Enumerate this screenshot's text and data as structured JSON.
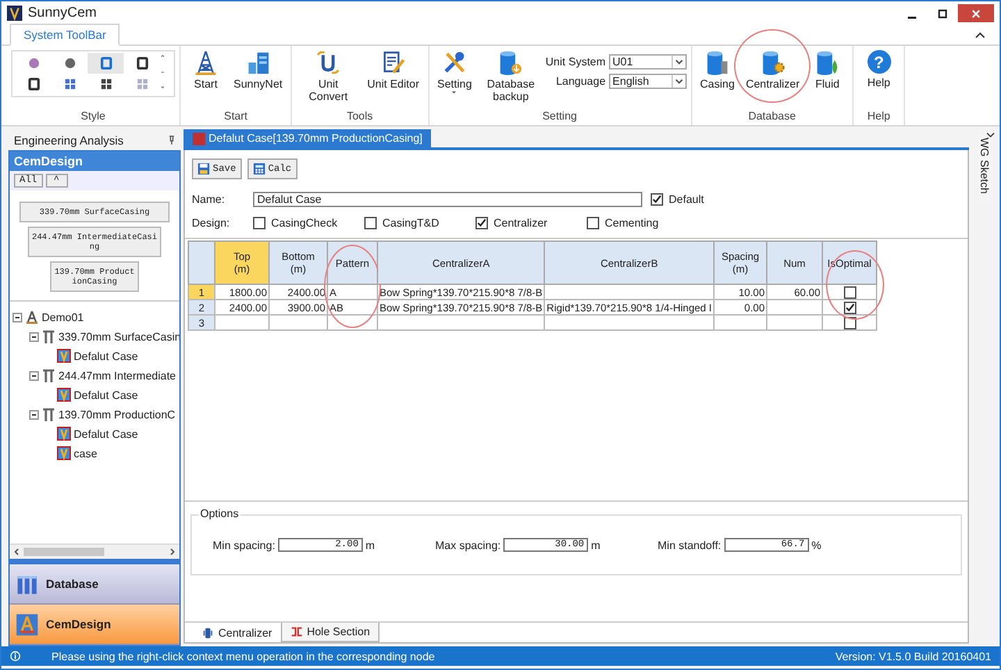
{
  "window": {
    "title": "SunnyCem"
  },
  "ribbon": {
    "tabs": [
      {
        "label": "System ToolBar",
        "selected": true
      }
    ],
    "style_gallery": [
      {
        "selected": false
      },
      {
        "selected": false
      },
      {
        "selected": true
      },
      {
        "selected": false
      },
      {
        "selected": false
      },
      {
        "selected": false
      },
      {
        "selected": false
      },
      {
        "selected": false
      }
    ],
    "groups": [
      {
        "label": "Style"
      },
      {
        "label": "Start",
        "buttons": [
          {
            "label": "Start",
            "circled": false
          },
          {
            "label": "SunnyNet",
            "circled": false
          }
        ]
      },
      {
        "label": "Tools",
        "buttons": [
          {
            "label": "Unit Convert",
            "circled": false
          },
          {
            "label": "Unit Editor",
            "circled": false
          }
        ]
      },
      {
        "label": "Setting",
        "buttons": [
          {
            "label": "Setting",
            "circled": false,
            "dropdown": true
          },
          {
            "label": "Database backup",
            "circled": false
          }
        ],
        "fields": [
          {
            "label": "Unit System",
            "value": "U01"
          },
          {
            "label": "Language",
            "value": "English"
          }
        ]
      },
      {
        "label": "Database",
        "buttons": [
          {
            "label": "Casing",
            "circled": false
          },
          {
            "label": "Centralizer",
            "circled": true
          },
          {
            "label": "Fluid",
            "circled": false
          }
        ]
      },
      {
        "label": "Help",
        "buttons": [
          {
            "label": "Help",
            "circled": false,
            "glyph": "?"
          }
        ]
      }
    ]
  },
  "sidebar": {
    "title": "Engineering Analysis",
    "section": "CemDesign",
    "tool_buttons": [
      {
        "label": "All"
      },
      {
        "label": "^"
      }
    ],
    "casing_buttons": [
      "339.70mm SurfaceCasing",
      "244.47mm IntermediateCasing",
      "139.70mm ProductionCasing"
    ],
    "tree": [
      {
        "label": "Demo01",
        "expanded": true,
        "children": [
          {
            "label": "339.70mm SurfaceCasin",
            "expanded": true,
            "children": [
              {
                "label": "Defalut Case"
              }
            ]
          },
          {
            "label": "244.47mm Intermediate",
            "expanded": true,
            "children": [
              {
                "label": "Defalut Case"
              }
            ]
          },
          {
            "label": "139.70mm ProductionC",
            "expanded": true,
            "children": [
              {
                "label": "Defalut Case"
              },
              {
                "label": "case"
              }
            ]
          }
        ]
      }
    ],
    "nav": [
      {
        "label": "Database",
        "selected": false
      },
      {
        "label": "CemDesign",
        "selected": true
      }
    ]
  },
  "document": {
    "tab": {
      "label": "Defalut Case[139.70mm ProductionCasing]",
      "selected": true
    },
    "toolbar": [
      "Save",
      "Calc"
    ],
    "name_label": "Name:",
    "name_value": "Defalut Case",
    "default": {
      "label": "Default",
      "checked": true
    },
    "design_label": "Design:",
    "design_options": [
      {
        "label": "CasingCheck",
        "checked": false
      },
      {
        "label": "CasingT&D",
        "checked": false
      },
      {
        "label": "Centralizer",
        "checked": true
      },
      {
        "label": "Cementing",
        "checked": false
      }
    ],
    "table": {
      "columns": [
        {
          "label": "Top\n(m)",
          "current": true,
          "circled": false
        },
        {
          "label": "Bottom\n(m)",
          "current": false,
          "circled": false
        },
        {
          "label": "Pattern",
          "current": false,
          "circled": true
        },
        {
          "label": "CentralizerA",
          "current": false,
          "circled": false
        },
        {
          "label": "CentralizerB",
          "current": false,
          "circled": false
        },
        {
          "label": "Spacing\n(m)",
          "current": false,
          "circled": false
        },
        {
          "label": "Num",
          "current": false,
          "circled": false
        },
        {
          "label": "IsOptimal",
          "current": false,
          "circled": true
        }
      ],
      "rows": [
        {
          "number": "1",
          "selected": true,
          "cells": [
            "1800.00",
            "2400.00",
            "A",
            "Bow Spring*139.70*215.90*8 7/8-B",
            null,
            "10.00",
            "60.00"
          ],
          "optimal": false
        },
        {
          "number": "2",
          "selected": false,
          "cells": [
            "2400.00",
            "3900.00",
            "AB",
            "Bow Spring*139.70*215.90*8 7/8-B",
            "Rigid*139.70*215.90*8 1/4-Hinged I",
            "0.00",
            null
          ],
          "optimal": true
        },
        {
          "number": "3",
          "selected": false,
          "cells": [
            null,
            null,
            null,
            null,
            null,
            null,
            null
          ],
          "optimal": false
        }
      ]
    },
    "options": {
      "title": "Options",
      "fields": [
        {
          "label": "Min spacing:",
          "value": "2.00",
          "unit": "m"
        },
        {
          "label": "Max spacing:",
          "value": "30.00",
          "unit": "m"
        },
        {
          "label": "Min standoff:",
          "value": "66.7",
          "unit": "%"
        }
      ]
    },
    "bottom_tabs": [
      {
        "label": "Centralizer",
        "selected": true
      },
      {
        "label": "Hole Section",
        "selected": false
      }
    ]
  },
  "right_panel": {
    "label": "WG Sketch"
  },
  "status_bar": {
    "message": "Please using the right-click context menu operation in the corresponding node",
    "version": "Version:  V1.5.0 Build 20160401"
  }
}
